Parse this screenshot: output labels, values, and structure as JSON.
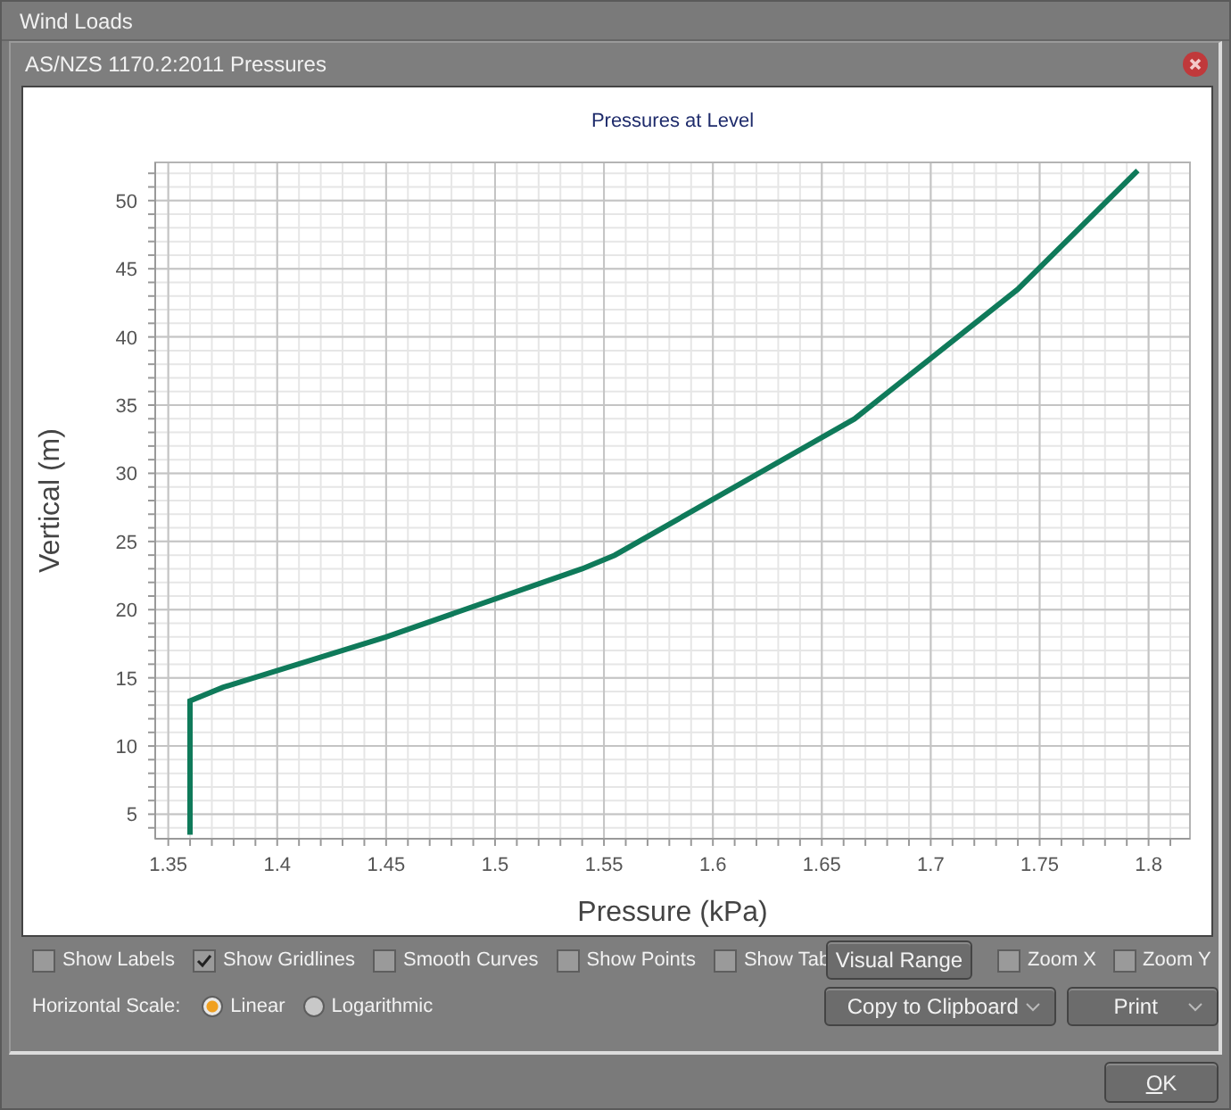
{
  "window": {
    "title": "Wind Loads"
  },
  "panel": {
    "title": "AS/NZS 1170.2:2011 Pressures"
  },
  "chart": {
    "chart_data": {
      "type": "line",
      "title": "Pressures at Level",
      "xlabel": "Pressure (kPa)",
      "ylabel": "Vertical (m)",
      "x": [
        1.36,
        1.36,
        1.375,
        1.45,
        1.54,
        1.555,
        1.665,
        1.74,
        1.795
      ],
      "grid": true,
      "series": [
        {
          "color": "#0f7a5a",
          "values": [
            3.5,
            13.3,
            14.3,
            18,
            23,
            24,
            34,
            43.5,
            52.2
          ]
        }
      ],
      "xlim": [
        1.344,
        1.819
      ],
      "ylim": [
        3.2,
        52.8
      ],
      "xticks": [
        1.35,
        1.4,
        1.45,
        1.5,
        1.55,
        1.6,
        1.65,
        1.7,
        1.75,
        1.8
      ],
      "yticks": [
        5,
        10,
        15,
        20,
        25,
        30,
        35,
        40,
        45,
        50
      ]
    }
  },
  "options": [
    {
      "label": "Show Labels",
      "checked": false
    },
    {
      "label": "Show Gridlines",
      "checked": true
    },
    {
      "label": "Smooth Curves",
      "checked": false
    },
    {
      "label": "Show Points",
      "checked": false
    },
    {
      "label": "Show Tab",
      "checked": false
    }
  ],
  "visual_range_button": "Visual Range",
  "zoom_options": [
    {
      "label": "Zoom X",
      "checked": false
    },
    {
      "label": "Zoom Y",
      "checked": false
    }
  ],
  "horizontal_scale": {
    "label": "Horizontal Scale:",
    "choices": [
      {
        "label": "Linear",
        "selected": true
      },
      {
        "label": "Logarithmic",
        "selected": false
      }
    ]
  },
  "buttons": [
    {
      "label": "Copy to Clipboard",
      "dropdown": true
    },
    {
      "label": "Print",
      "dropdown": true
    }
  ],
  "ok_button": "OK"
}
